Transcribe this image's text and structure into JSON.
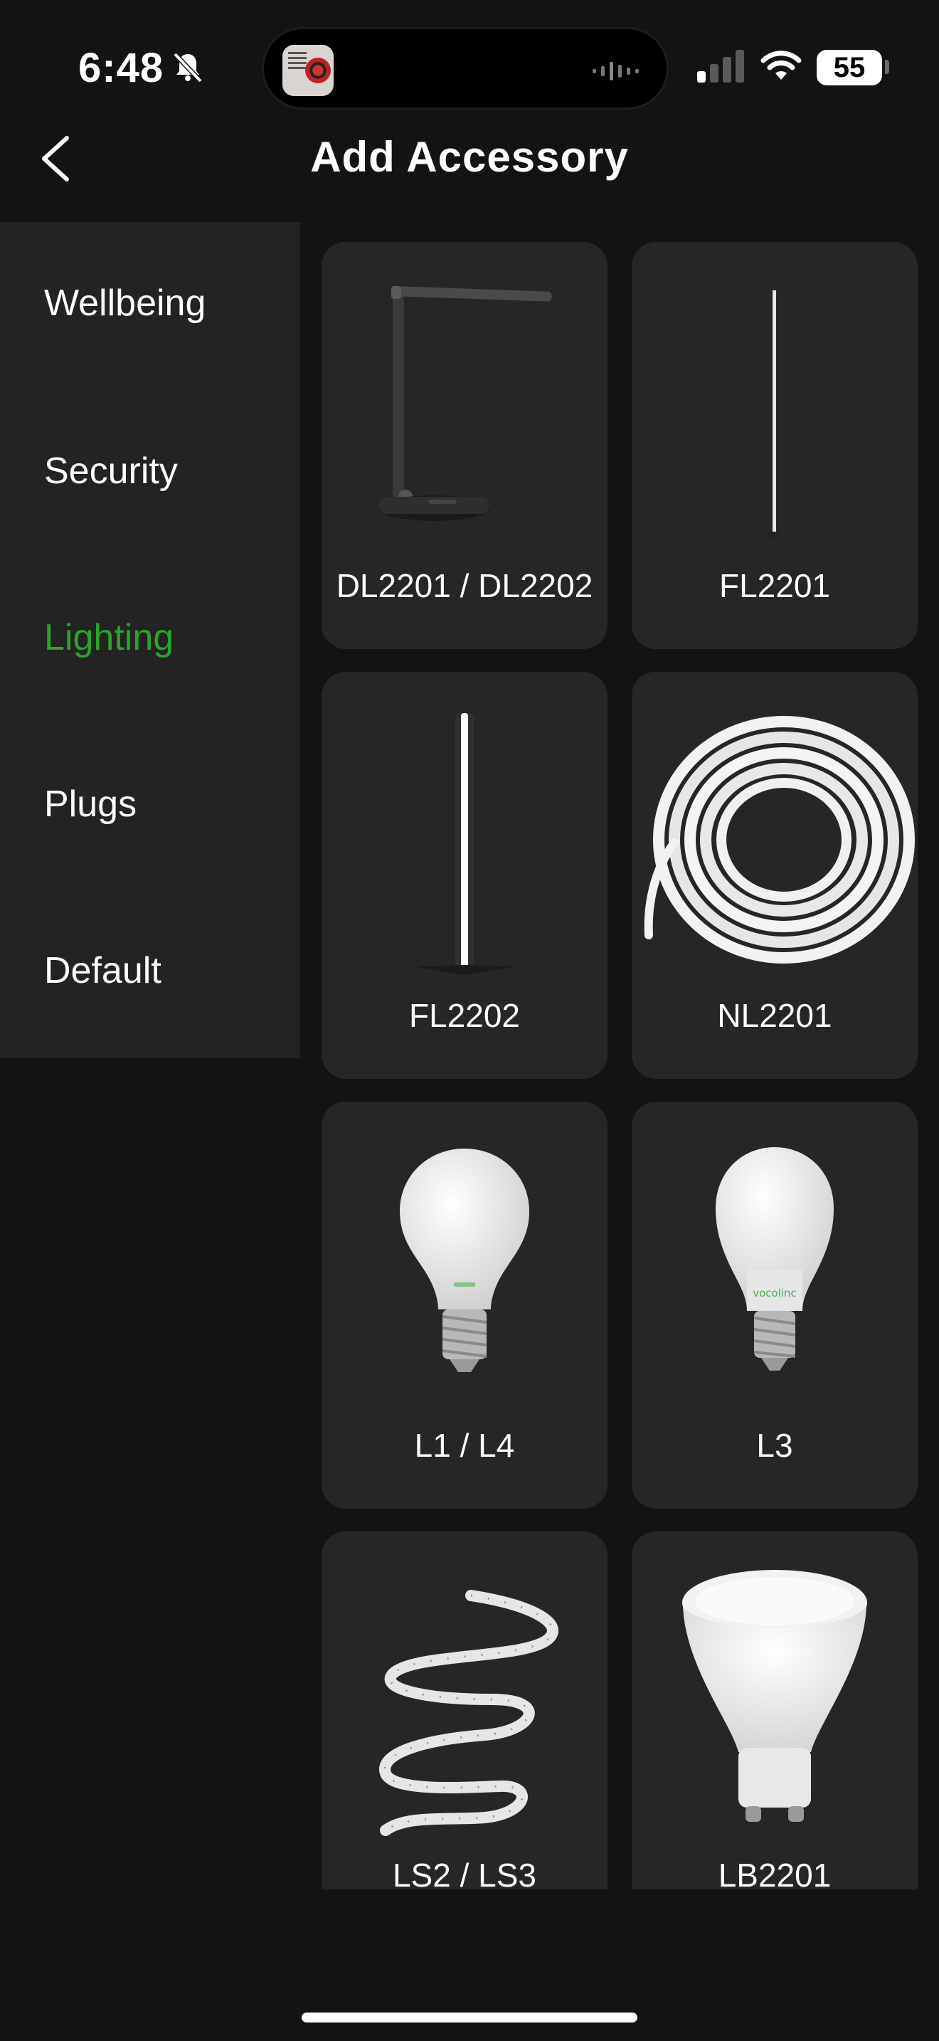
{
  "status_bar": {
    "time": "6:48",
    "battery": "55",
    "silent_icon": "bell-slash-icon",
    "signal_icon": "cellular-signal-icon",
    "wifi_icon": "wifi-icon"
  },
  "header": {
    "title": "Add Accessory",
    "back_icon": "chevron-left-icon"
  },
  "sidebar": {
    "items": [
      {
        "label": "Wellbeing",
        "active": false
      },
      {
        "label": "Security",
        "active": false
      },
      {
        "label": "Lighting",
        "active": true
      },
      {
        "label": "Plugs",
        "active": false
      },
      {
        "label": "Default",
        "active": false
      }
    ]
  },
  "products": [
    {
      "label": "DL2201 / DL2202",
      "image": "desk-lamp"
    },
    {
      "label": "FL2201",
      "image": "floor-lamp-thin"
    },
    {
      "label": "FL2202",
      "image": "floor-lamp-glow"
    },
    {
      "label": "NL2201",
      "image": "neon-light-coil"
    },
    {
      "label": "L1 / L4",
      "image": "a19-bulb"
    },
    {
      "label": "L3",
      "image": "a21-bulb"
    },
    {
      "label": "LS2 / LS3",
      "image": "light-strip-spiral"
    },
    {
      "label": "LB2201",
      "image": "gu10-spot-bulb"
    }
  ],
  "colors": {
    "background": "#131313",
    "sidebar": "#232323",
    "card": "#262626",
    "accent_active": "#2aa52a"
  }
}
